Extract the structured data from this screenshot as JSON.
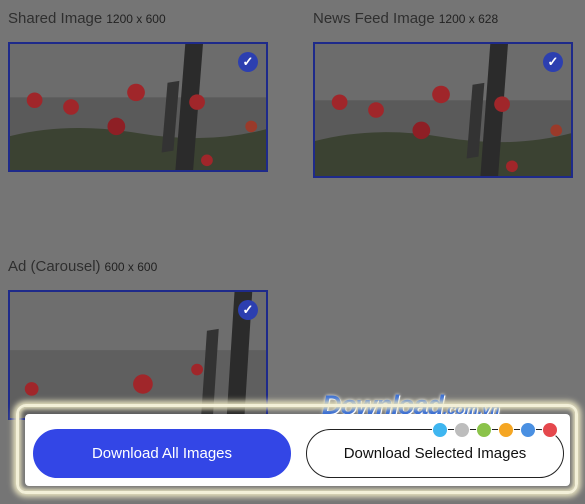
{
  "cards": [
    {
      "title": "Shared Image",
      "dims": "1200 x 600",
      "selected": true
    },
    {
      "title": "News Feed Image",
      "dims": "1200 x 628",
      "selected": true
    },
    {
      "title": "Ad (Carousel)",
      "dims": "600 x 600",
      "selected": true
    }
  ],
  "check_icon": "check-icon",
  "actions": {
    "download_all": "Download All Images",
    "download_selected": "Download Selected Images"
  },
  "watermark": {
    "main": "Download",
    "suffix": ".com.vn"
  },
  "colors": {
    "accent": "#3346e6",
    "overlay": "#757575",
    "border": "#1e2a8a",
    "dots": [
      "#3fb6f0",
      "#bdbdbd",
      "#8bc34a",
      "#f5a623",
      "#4a90e2",
      "#e5484d"
    ]
  }
}
